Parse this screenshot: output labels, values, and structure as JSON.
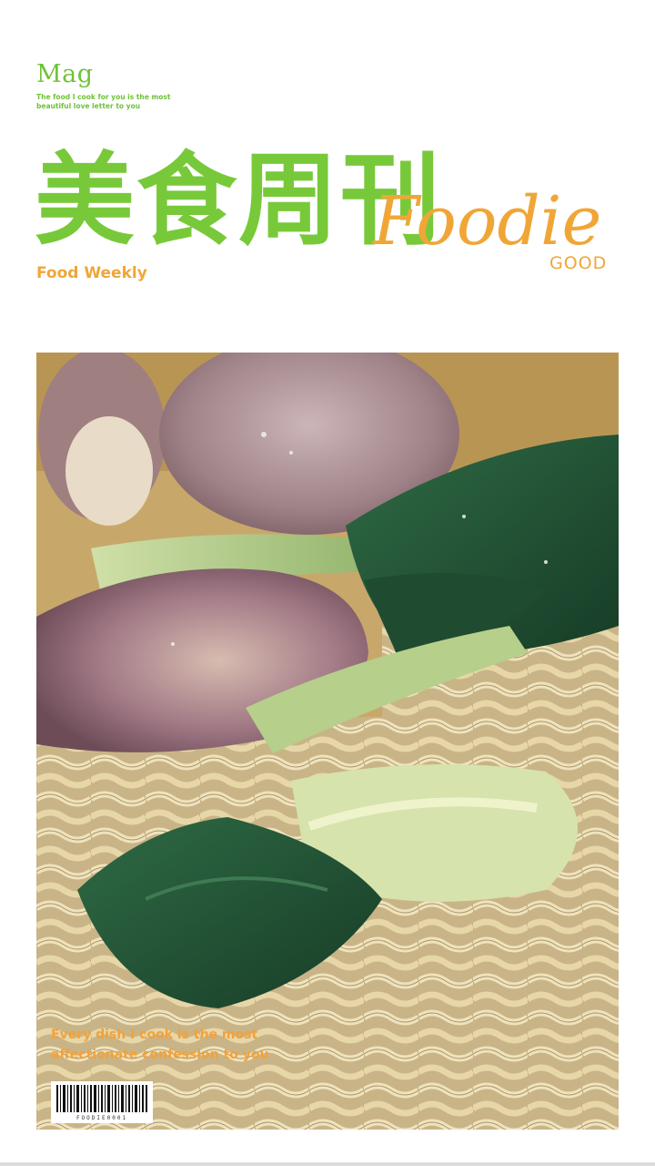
{
  "header": {
    "logo": "Mag",
    "tagline": "The food I cook for you is the most beautiful love letter to you"
  },
  "title": {
    "chinese": "美食周刊",
    "script": "Foodie",
    "good": "GOOD",
    "subtitle": "Food Weekly"
  },
  "cover": {
    "caption": "Every dish I cook is the most affectionate confession to you",
    "barcode_number": "FOODIE0001"
  },
  "colors": {
    "green": "#78c93a",
    "orange": "#f0a637",
    "background": "#ffffff"
  }
}
